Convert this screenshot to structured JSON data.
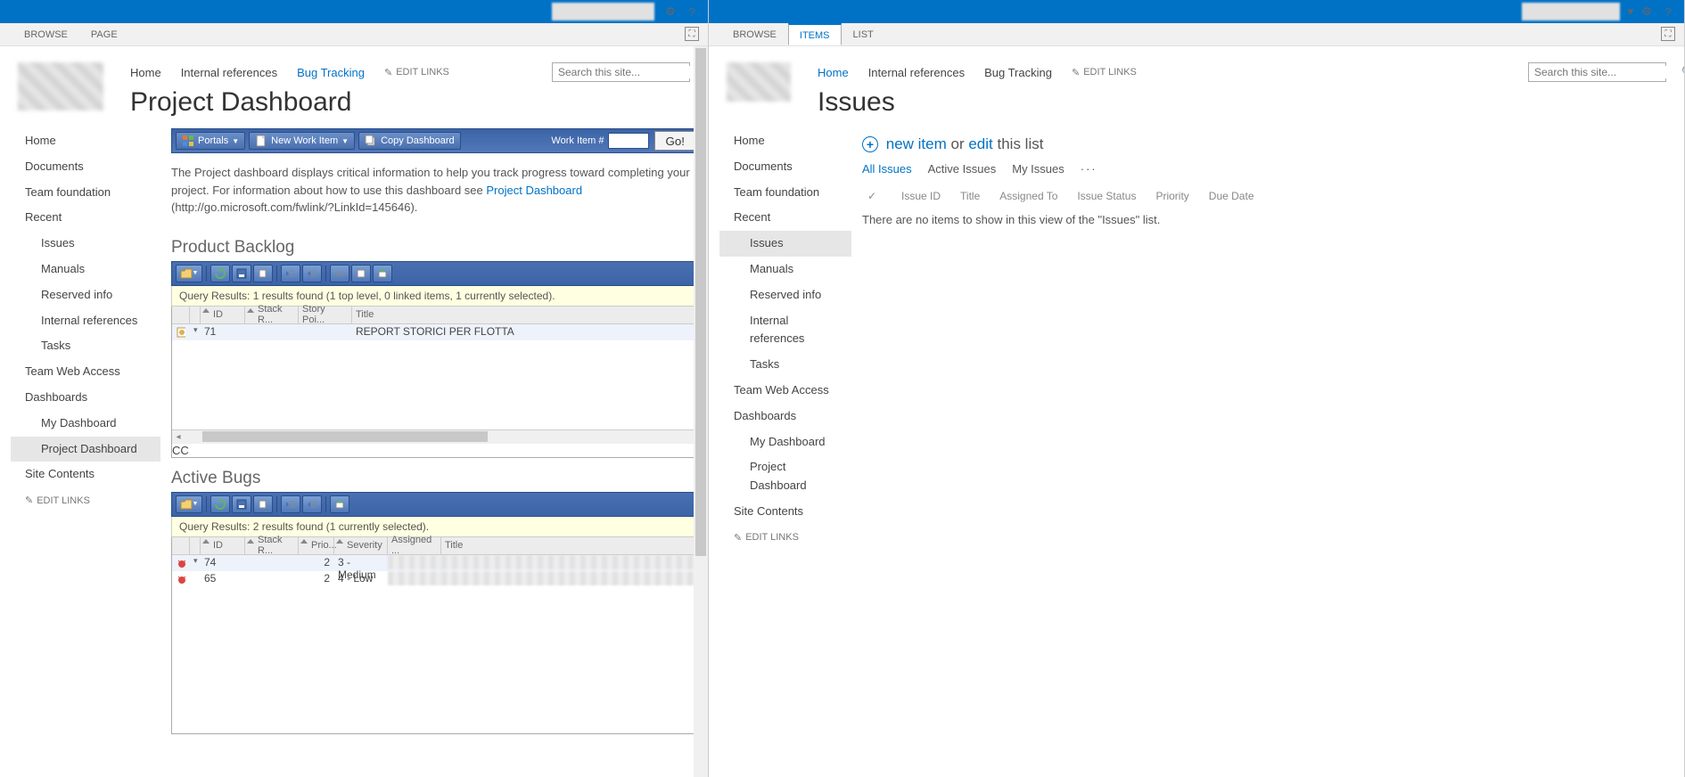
{
  "left": {
    "ribbon_tabs": [
      "BROWSE",
      "PAGE"
    ],
    "top_nav": [
      {
        "label": "Home",
        "active": false
      },
      {
        "label": "Internal references",
        "active": false
      },
      {
        "label": "Bug Tracking",
        "active": true
      }
    ],
    "edit_links_label": "EDIT LINKS",
    "search_placeholder": "Search this site...",
    "page_title": "Project Dashboard",
    "sidenav": [
      {
        "label": "Home"
      },
      {
        "label": "Documents"
      },
      {
        "label": "Team foundation"
      },
      {
        "label": "Recent"
      },
      {
        "label": "Issues",
        "sub": true
      },
      {
        "label": "Manuals",
        "sub": true
      },
      {
        "label": "Reserved info",
        "sub": true
      },
      {
        "label": "Internal references",
        "sub": true
      },
      {
        "label": "Tasks",
        "sub": true
      },
      {
        "label": "Team Web Access"
      },
      {
        "label": "Dashboards"
      },
      {
        "label": "My Dashboard",
        "sub": true
      },
      {
        "label": "Project Dashboard",
        "sub": true,
        "selected": true
      },
      {
        "label": "Site Contents"
      }
    ],
    "toolbar": {
      "portals": "Portals",
      "new_work_item": "New Work Item",
      "copy_dashboard": "Copy Dashboard",
      "work_item_label": "Work Item #",
      "go": "Go!"
    },
    "intro_text_1": "The Project dashboard displays critical information to help you track progress toward completing your project. For information about how to use this dashboard see ",
    "intro_link": "Project Dashboard",
    "intro_text_2": " (http://go.microsoft.com/fwlink/?LinkId=145646).",
    "sections": {
      "backlog": {
        "title": "Product Backlog",
        "query_results": "Query Results: 1 results found (1 top level, 0 linked items, 1 currently selected).",
        "columns": [
          "ID",
          "Stack R...",
          "Story Poi...",
          "Title"
        ],
        "rows": [
          {
            "id": "71",
            "stack": "",
            "story": "",
            "title": "REPORT STORICI PER FLOTTA"
          }
        ]
      },
      "bugs": {
        "title": "Active Bugs",
        "query_results": "Query Results: 2 results found (1 currently selected).",
        "columns": [
          "ID",
          "Stack R...",
          "Prio...",
          "Severity",
          "Assigned ...",
          "Title"
        ],
        "rows": [
          {
            "id": "74",
            "stack": "",
            "prio": "2",
            "severity": "3 - Medium",
            "assigned": "",
            "title": ""
          },
          {
            "id": "65",
            "stack": "",
            "prio": "2",
            "severity": "4 - Low",
            "assigned": "",
            "title": ""
          }
        ]
      }
    }
  },
  "right": {
    "ribbon_tabs": [
      {
        "label": "BROWSE",
        "active": false
      },
      {
        "label": "ITEMS",
        "active": true
      },
      {
        "label": "LIST",
        "active": false
      }
    ],
    "top_nav": [
      {
        "label": "Home",
        "active": true
      },
      {
        "label": "Internal references",
        "active": false
      },
      {
        "label": "Bug Tracking",
        "active": false
      }
    ],
    "edit_links_label": "EDIT LINKS",
    "search_placeholder": "Search this site...",
    "page_title": "Issues",
    "sidenav": [
      {
        "label": "Home"
      },
      {
        "label": "Documents"
      },
      {
        "label": "Team foundation"
      },
      {
        "label": "Recent"
      },
      {
        "label": "Issues",
        "sub": true,
        "selected": true
      },
      {
        "label": "Manuals",
        "sub": true
      },
      {
        "label": "Reserved info",
        "sub": true
      },
      {
        "label": "Internal references",
        "sub": true
      },
      {
        "label": "Tasks",
        "sub": true
      },
      {
        "label": "Team Web Access"
      },
      {
        "label": "Dashboards"
      },
      {
        "label": "My Dashboard",
        "sub": true
      },
      {
        "label": "Project Dashboard",
        "sub": true
      },
      {
        "label": "Site Contents"
      }
    ],
    "list_actions": {
      "new_item": "new item",
      "or": " or ",
      "edit": "edit",
      "this_list": " this list"
    },
    "view_tabs": [
      "All Issues",
      "Active Issues",
      "My Issues"
    ],
    "list_columns": [
      "Issue ID",
      "Title",
      "Assigned To",
      "Issue Status",
      "Priority",
      "Due Date"
    ],
    "empty_text": "There are no items to show in this view of the \"Issues\" list."
  }
}
